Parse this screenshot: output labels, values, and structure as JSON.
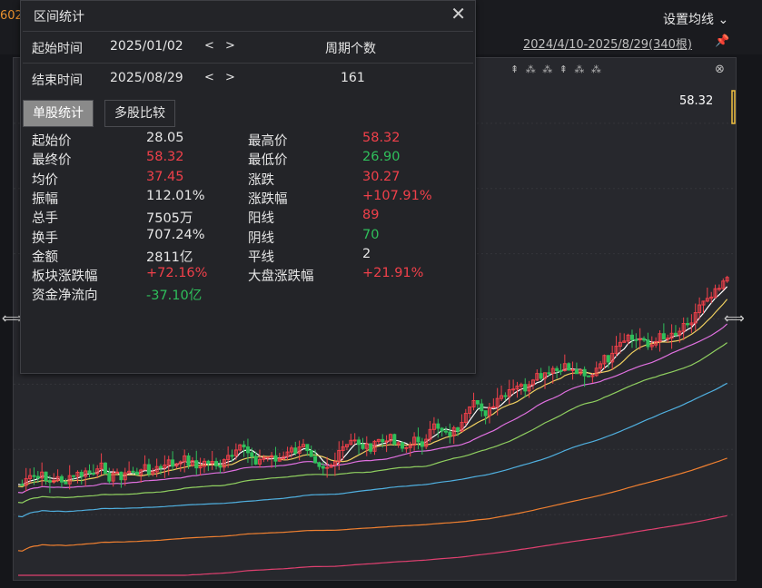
{
  "top": {
    "edge_number": "602",
    "ma_settings_label": "设置均线",
    "range_label": "2024/4/10-2025/8/29(340根)",
    "toolbar_icons": "⇞ ⁂ ⁂ ⇞ ⁂ ⁂",
    "latest_price": "58.32"
  },
  "dialog": {
    "title": "区间统计",
    "start_label": "起始时间",
    "start_date": "2025/01/02",
    "end_label": "结束时间",
    "end_date": "2025/08/29",
    "nav_arrows": "< >",
    "period_label": "周期个数",
    "period_value": "161",
    "tabs": [
      "单股统计",
      "多股比较"
    ],
    "stats": [
      {
        "label": "起始价",
        "value": "28.05",
        "color": "white"
      },
      {
        "label": "最高价",
        "value": "58.32",
        "color": "red"
      },
      {
        "label": "最终价",
        "value": "58.32",
        "color": "red"
      },
      {
        "label": "最低价",
        "value": "26.90",
        "color": "green"
      },
      {
        "label": "均价",
        "value": "37.45",
        "color": "red"
      },
      {
        "label": "涨跌",
        "value": "30.27",
        "color": "red"
      },
      {
        "label": "振幅",
        "value": "112.01%",
        "color": "white"
      },
      {
        "label": "涨跌幅",
        "value": "+107.91%",
        "color": "red"
      },
      {
        "label": "总手",
        "value": "7505万",
        "color": "white"
      },
      {
        "label": "阳线",
        "value": "89",
        "color": "red"
      },
      {
        "label": "换手",
        "value": "707.24%",
        "color": "white"
      },
      {
        "label": "阴线",
        "value": "70",
        "color": "green"
      },
      {
        "label": "金额",
        "value": "2811亿",
        "color": "white"
      },
      {
        "label": "平线",
        "value": "2",
        "color": "white"
      },
      {
        "label": "板块涨跌幅",
        "value": "+72.16%",
        "color": "red"
      },
      {
        "label": "大盘涨跌幅",
        "value": "+21.91%",
        "color": "red"
      },
      {
        "label": "资金净流向",
        "value": "-37.10亿",
        "color": "green"
      }
    ]
  },
  "colors": {
    "up": "#f0404a",
    "down": "#2fbf5b",
    "flat": "#e6e6e6",
    "ma_lines": [
      "#ffffff",
      "#f0d060",
      "#e070e0",
      "#90d060",
      "#50b0e0",
      "#f08030",
      "#e04070"
    ],
    "highlight_bar": "#f0c040"
  }
}
